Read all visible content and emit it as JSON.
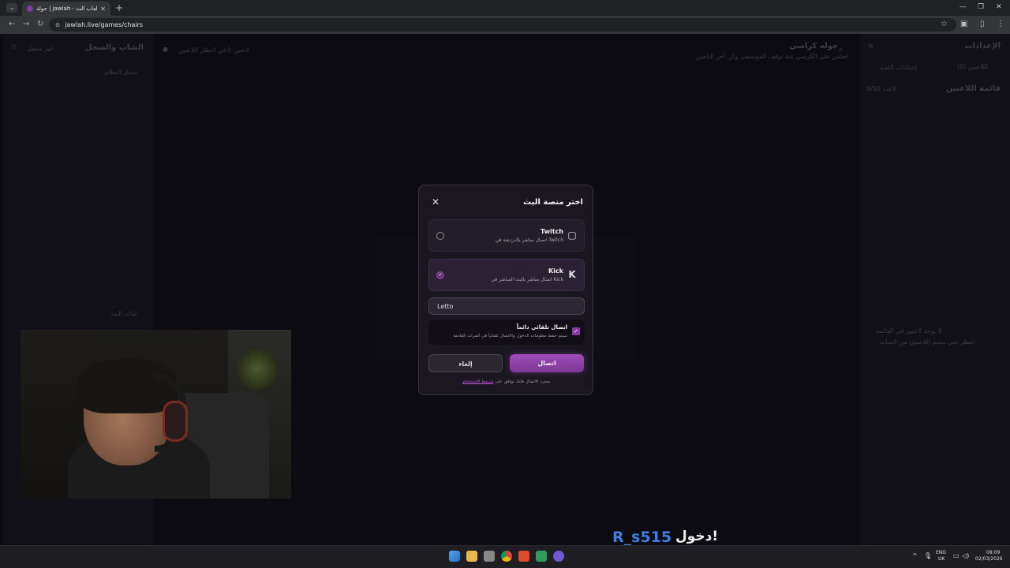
{
  "browser": {
    "tab_title": "جولة | jawlah - منصة الألعاب الت...",
    "tab_close": "✕",
    "new_tab": "+",
    "url": "jawlah.live/games/chairs",
    "win_min": "—",
    "win_max": "❐",
    "win_close": "✕"
  },
  "sidebar_right": {
    "title": "الإعدادات",
    "tab_players": "اللاعبين (0)",
    "tab_settings": "إعدادات اللعبة",
    "list_title": "قائمة اللاعبين",
    "list_count": "0/50 لاعب",
    "empty_title": "لا يوجد لاعبين في القائمة",
    "empty_sub": "انتظر حتى ينضم اللاعبون من الشات"
  },
  "header": {
    "game_title": "جوله كراسي",
    "game_sub": "اجلس على الكرسي عند توقف الموسيقى وكن آخر الناجين",
    "waiting": "في انتظار اللاعبين",
    "players_count": "0 لاعبين"
  },
  "sidebar_left": {
    "title": "الشات والسجل",
    "disconnected": "غير متصل",
    "system_log": "سجل النظام",
    "stream_chat": "شات البث"
  },
  "modal": {
    "title": "اختر منصة البث",
    "close_icon": "✕",
    "options": [
      {
        "name": "Twitch",
        "desc": "اتصال مباشر بالدردشة في Twitch",
        "icon": "twitch-icon",
        "selected": false
      },
      {
        "name": "Kick",
        "desc": "اتصال مباشر بالبث المباشر في Kick",
        "icon": "kick-icon",
        "selected": true
      }
    ],
    "username_value": "Letto",
    "auto_connect_title": "اتصال تلقائي دائماً",
    "auto_connect_desc": "سيتم حفظ معلومات الدخول والاتصال تلقائياً في المرات القادمة",
    "connect_label": "اتصال",
    "cancel_label": "إلغاء",
    "terms_text": "بمجرد الاتصال فإنك توافق على",
    "terms_link": "شروط الاستخدام"
  },
  "overlay": {
    "username": "R_s515",
    "action": "دخول!"
  },
  "taskbar": {
    "lang_top": "ENG",
    "lang_bottom": "UK",
    "time": "08:09",
    "date": "02/03/2026",
    "tray_up": "^"
  },
  "colors": {
    "accent": "#9b48b5",
    "link": "#c055d8",
    "overlay_name": "#3f7de0"
  }
}
